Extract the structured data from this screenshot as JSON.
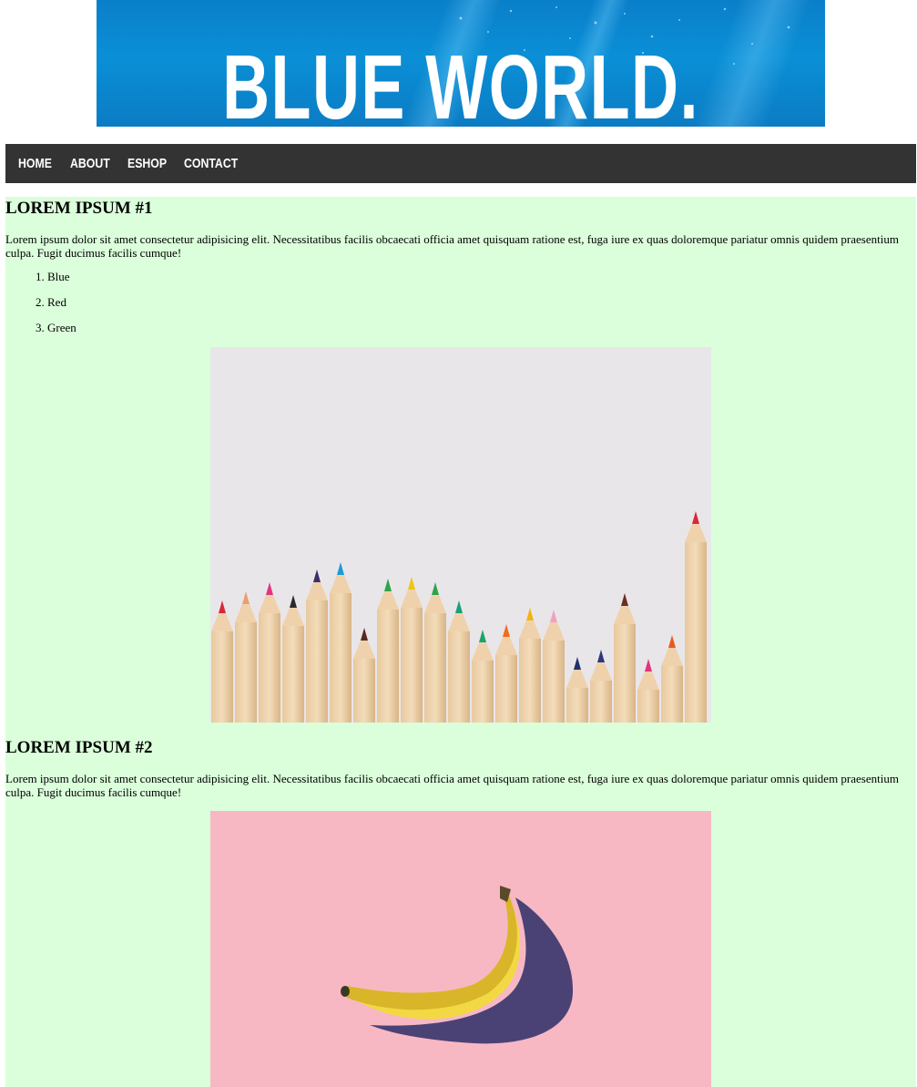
{
  "banner": {
    "title": "BLUE WORLD.",
    "image": "underwater-blue-banner"
  },
  "nav": {
    "items": [
      {
        "label": "HOME"
      },
      {
        "label": "ABOUT"
      },
      {
        "label": "ESHOP"
      },
      {
        "label": "CONTACT"
      }
    ]
  },
  "sections": [
    {
      "heading": "LOREM IPSUM #1",
      "text": "Lorem ipsum dolor sit amet consectetur adipisicing elit. Necessitatibus facilis obcaecati officia amet quisquam ratione est, fuga iure ex quas doloremque pariatur omnis quidem praesentium culpa. Fugit ducimus facilis cumque!",
      "list": [
        "1. Blue",
        "2. Red",
        "3. Green"
      ],
      "image": "colored-pencils-photo"
    },
    {
      "heading": "LOREM IPSUM #2",
      "text": "Lorem ipsum dolor sit amet consectetur adipisicing elit. Necessitatibus facilis obcaecati officia amet quisquam ratione est, fuga iure ex quas doloremque pariatur omnis quidem praesentium culpa. Fugit ducimus facilis cumque!",
      "image": "banana-on-pink-photo"
    }
  ],
  "colors": {
    "nav_bg": "#333333",
    "content_bg": "#dbffdb",
    "banner_blue": "#0a8fd6",
    "banana_bg": "#f7b8c4"
  }
}
